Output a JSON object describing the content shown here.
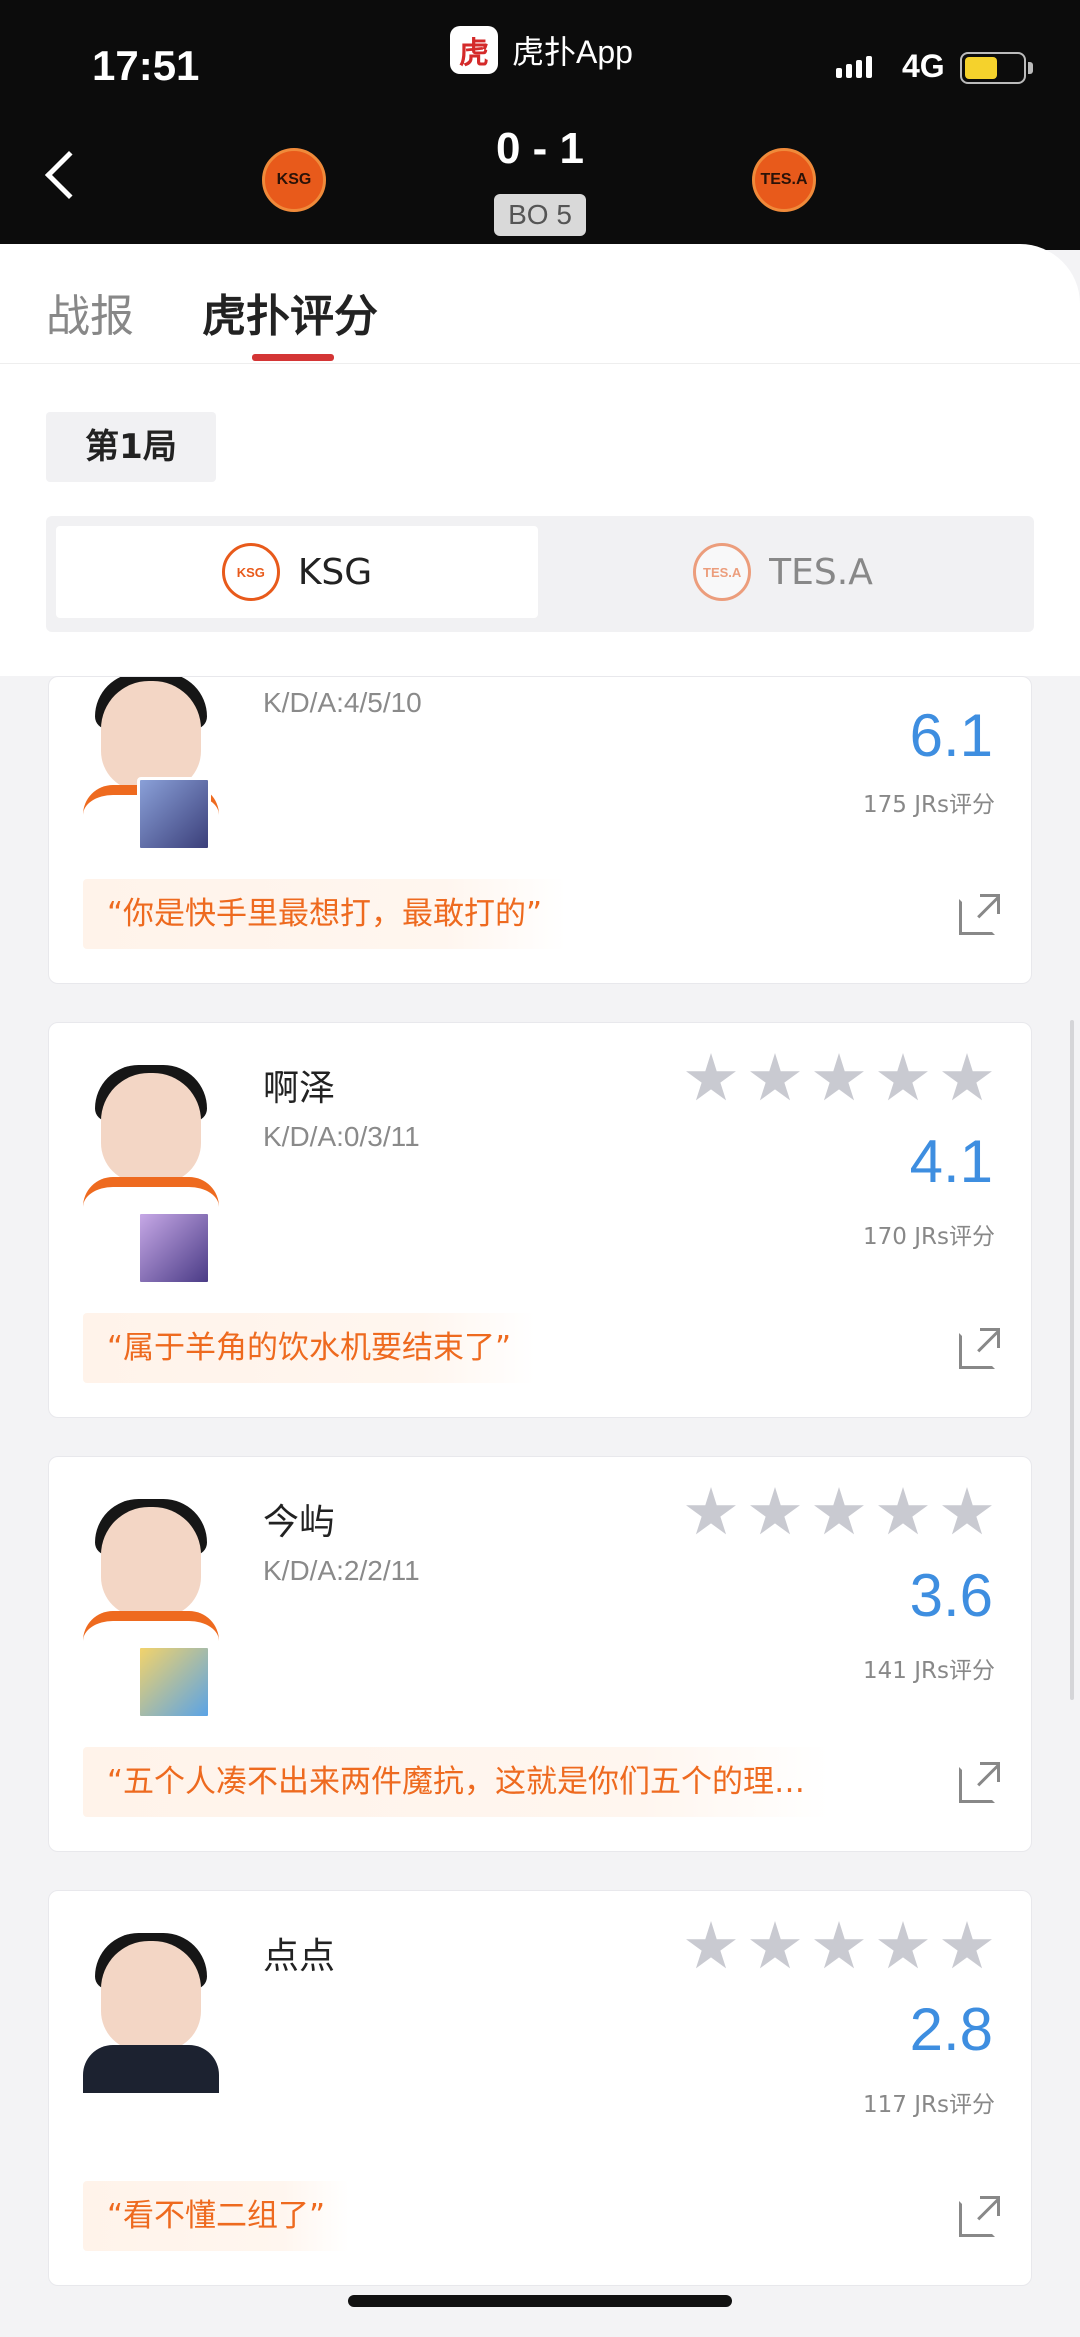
{
  "status_bar": {
    "time": "17:51",
    "app": "虎扑App",
    "network": "4G",
    "battery_level": 0.58
  },
  "match": {
    "home_team": "KSG",
    "away_team": "TES.A",
    "score": "0 - 1",
    "format": "BO 5",
    "brand_color": "#e85a1b"
  },
  "tabs": [
    {
      "label": "战报",
      "active": false
    },
    {
      "label": "虎扑评分",
      "active": true
    }
  ],
  "game_label": "第1局",
  "team_switch": [
    {
      "label": "KSG",
      "selected": true
    },
    {
      "label": "TES.A",
      "selected": false
    }
  ],
  "players": [
    {
      "name": "",
      "kda": "K/D/A:4/5/10",
      "rating": "6.1",
      "votes": "175 JRs评分",
      "comment": "“你是快手里最想打，最敢打的”",
      "stars_filled": 0
    },
    {
      "name": "啊泽",
      "kda": "K/D/A:0/3/11",
      "rating": "4.1",
      "votes": "170 JRs评分",
      "comment": "“属于羊角的饮水机要结束了”",
      "stars_filled": 0
    },
    {
      "name": "今屿",
      "kda": "K/D/A:2/2/11",
      "rating": "3.6",
      "votes": "141 JRs评分",
      "comment": "“五个人凑不出来两件魔抗，这就是你们五个的理…",
      "stars_filled": 0
    },
    {
      "name": "点点",
      "kda": "",
      "rating": "2.8",
      "votes": "117 JRs评分",
      "comment": "“看不懂二组了”",
      "stars_filled": 0
    }
  ],
  "colors": {
    "accent_red": "#d43535",
    "rating_blue": "#3e8ee0",
    "comment_orange": "#ee6a1f"
  }
}
